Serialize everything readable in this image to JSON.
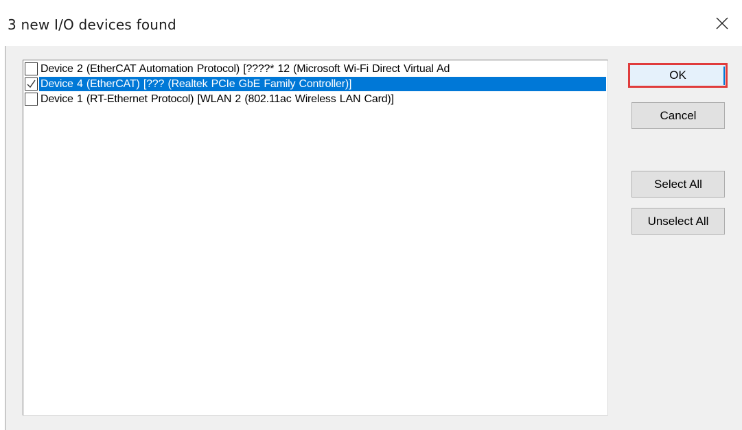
{
  "dialog": {
    "title": "3 new I/O devices found",
    "close_icon": "close-icon"
  },
  "devices": [
    {
      "label": "Device 2 (EtherCAT Automation Protocol)     [????* 12 (Microsoft Wi-Fi Direct Virtual Ad",
      "checked": false,
      "selected": false
    },
    {
      "label": "Device 4 (EtherCAT)     [??? (Realtek PCIe GbE Family Controller)]",
      "checked": true,
      "selected": true
    },
    {
      "label": "Device 1 (RT-Ethernet Protocol)     [WLAN 2 (802.11ac Wireless LAN Card)]",
      "checked": false,
      "selected": false
    }
  ],
  "buttons": {
    "ok": "OK",
    "cancel": "Cancel",
    "select_all": "Select All",
    "unselect_all": "Unselect All"
  },
  "colors": {
    "selection": "#0078d7",
    "ok_highlight": "#e03c3c",
    "dialog_background": "#f0f0f0"
  }
}
